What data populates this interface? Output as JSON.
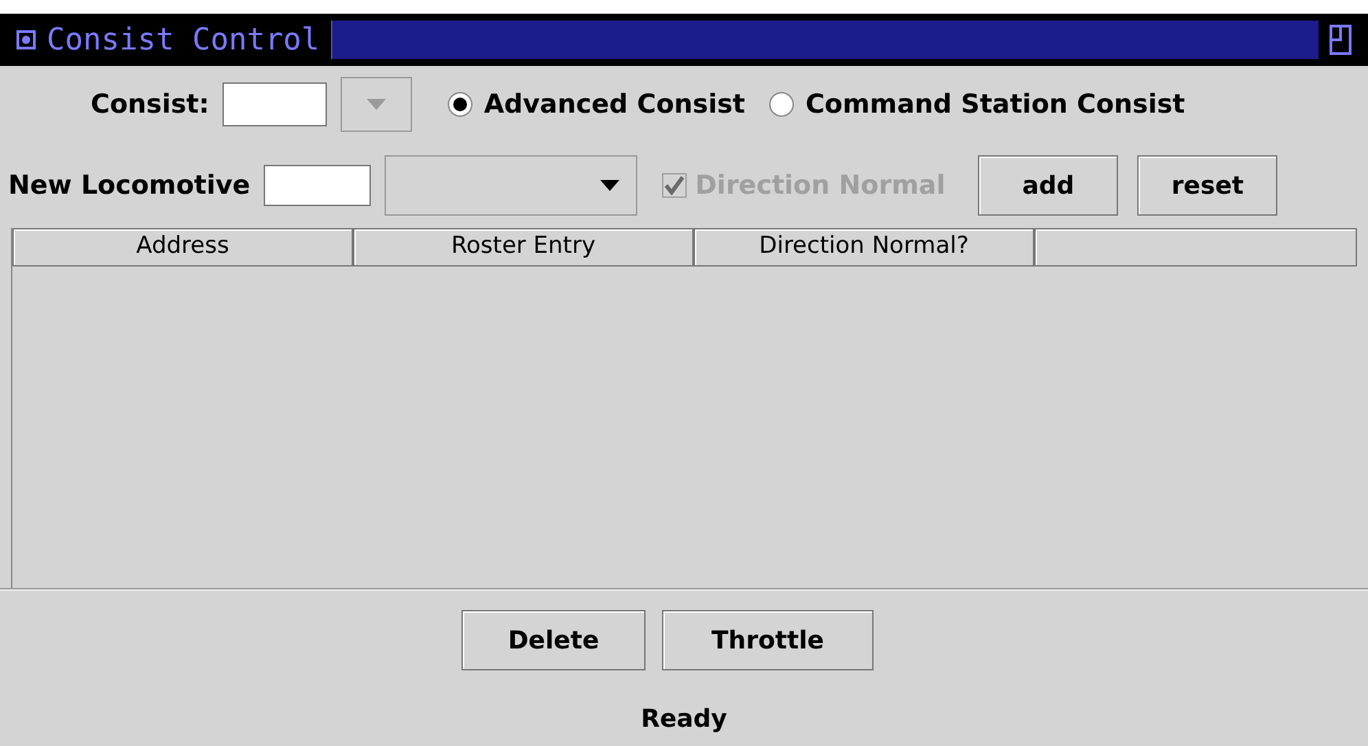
{
  "window": {
    "title": "Consist Control"
  },
  "consist": {
    "label": "Consist:",
    "dropdown_disabled": true
  },
  "consist_types": [
    {
      "label": "Advanced Consist",
      "selected": true
    },
    {
      "label": "Command Station Consist",
      "selected": false
    }
  ],
  "new_locomotive": {
    "label": "New Locomotive",
    "direction_normal": {
      "label": "Direction Normal",
      "checked": true,
      "disabled": true
    }
  },
  "top_buttons": [
    "add",
    "reset"
  ],
  "table": {
    "columns": [
      "Address",
      "Roster Entry",
      "Direction Normal?",
      ""
    ]
  },
  "bottom_buttons": [
    "Delete",
    "Throttle"
  ],
  "status_bar": "Ready"
}
